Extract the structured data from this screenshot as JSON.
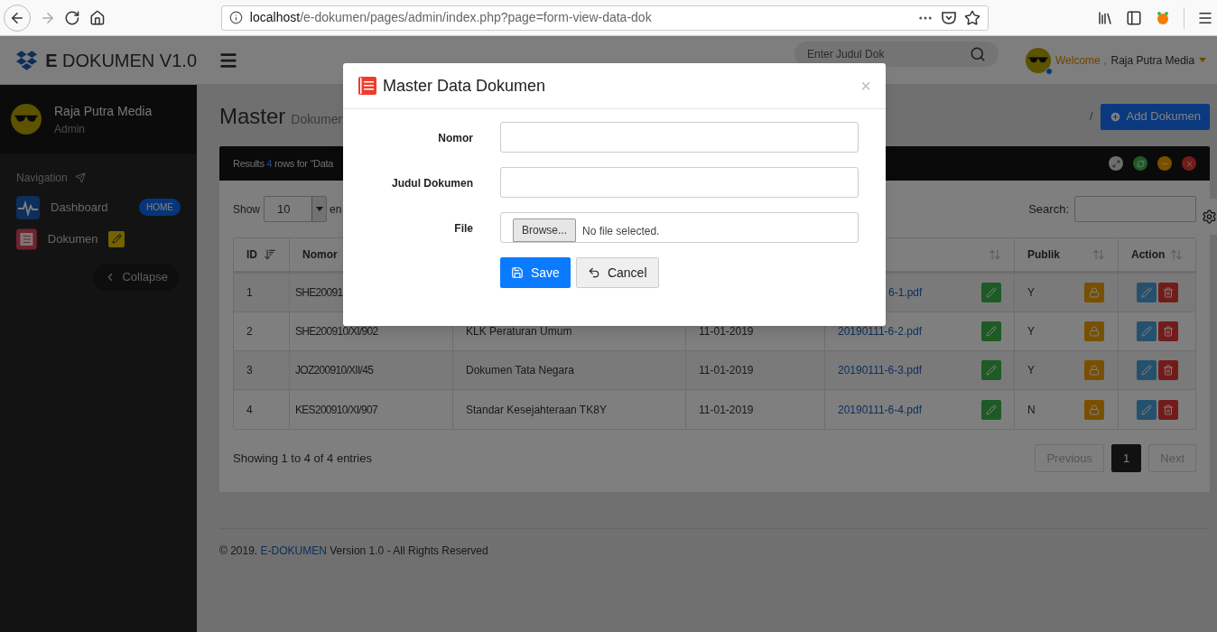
{
  "browser": {
    "url_host": "localhost",
    "url_path": "/e-dokumen/pages/admin/index.php?page=form-view-data-dok"
  },
  "header": {
    "logo": "**E** DOKUMEN V1.0",
    "search_placeholder": "Enter Judul Dok",
    "welcome": "Welcome ,",
    "user": "Raja Putra Media"
  },
  "sidebar": {
    "name": "Raja Putra Media",
    "role": "Admin",
    "nav_label": "Navigation",
    "items": [
      {
        "label": "Dashboard",
        "kind": "dashboard",
        "badge": {
          "kind": "label",
          "text": "HOME"
        }
      },
      {
        "label": "Dokumen",
        "kind": "document",
        "badge": {
          "kind": "edit"
        }
      }
    ],
    "collapse": "Collapse"
  },
  "page": {
    "title": "Master",
    "subtitle": "Dokumen",
    "breadcrumb_sep": "/",
    "add_button": "Add Dokumen"
  },
  "panel": {
    "results_prefix": "Results",
    "results_count": "4",
    "results_suffix": "rows for \"Data",
    "show_label": "Show",
    "page_size": "10",
    "entries_label": "en",
    "search_label": "Search:"
  },
  "table": {
    "columns": [
      {
        "label": "ID",
        "sorted": true
      },
      {
        "label": "Nomor"
      },
      {},
      {},
      {
        "sorted": false
      },
      {
        "label": "Publik",
        "sorted": false
      },
      {
        "label": "Action",
        "sorted": false
      }
    ],
    "rows": [
      {
        "id": "1",
        "nomor": "SHE20091",
        "file": "6-1.pdf",
        "publik": "Y"
      },
      {
        "id": "2",
        "nomor": "SHE200910/XI/902",
        "judul": "KLK Peraturan Umum",
        "tanggal": "11-01-2019",
        "file": "20190111-6-2.pdf",
        "publik": "Y"
      },
      {
        "id": "3",
        "nomor": "JOZ200910/XII/45",
        "judul": "Dokumen Tata Negara",
        "tanggal": "11-01-2019",
        "file": "20190111-6-3.pdf",
        "publik": "Y"
      },
      {
        "id": "4",
        "nomor": "KES200910/XI/907",
        "judul": "Standar Kesejahteraan TK8Y",
        "tanggal": "11-01-2019",
        "file": "20190111-6-4.pdf",
        "publik": "N"
      }
    ]
  },
  "info": "Showing 1 to 4 of 4 entries",
  "pagination": [
    {
      "label": "Previous",
      "disabled": true,
      "selected": false
    },
    {
      "label": "1",
      "disabled": false,
      "selected": true
    },
    {
      "label": "Next",
      "disabled": true,
      "selected": false
    }
  ],
  "footer": {
    "prefix": "© 2019.",
    "link": "E-DOKUMEN",
    "suffix": "Version 1.0 - All Rights Reserved"
  },
  "dialog": {
    "title": "Master Data Dokumen",
    "close": "×",
    "fields": [
      {
        "label": "Nomor",
        "kind": "text"
      },
      {
        "label": "Judul Dokumen",
        "kind": "text"
      },
      {
        "label": "File",
        "kind": "file",
        "button": "Browse...",
        "status": "No file selected."
      }
    ],
    "buttons": [
      {
        "label": "Save",
        "kind": "primary"
      },
      {
        "label": "Cancel",
        "kind": "default"
      }
    ]
  }
}
